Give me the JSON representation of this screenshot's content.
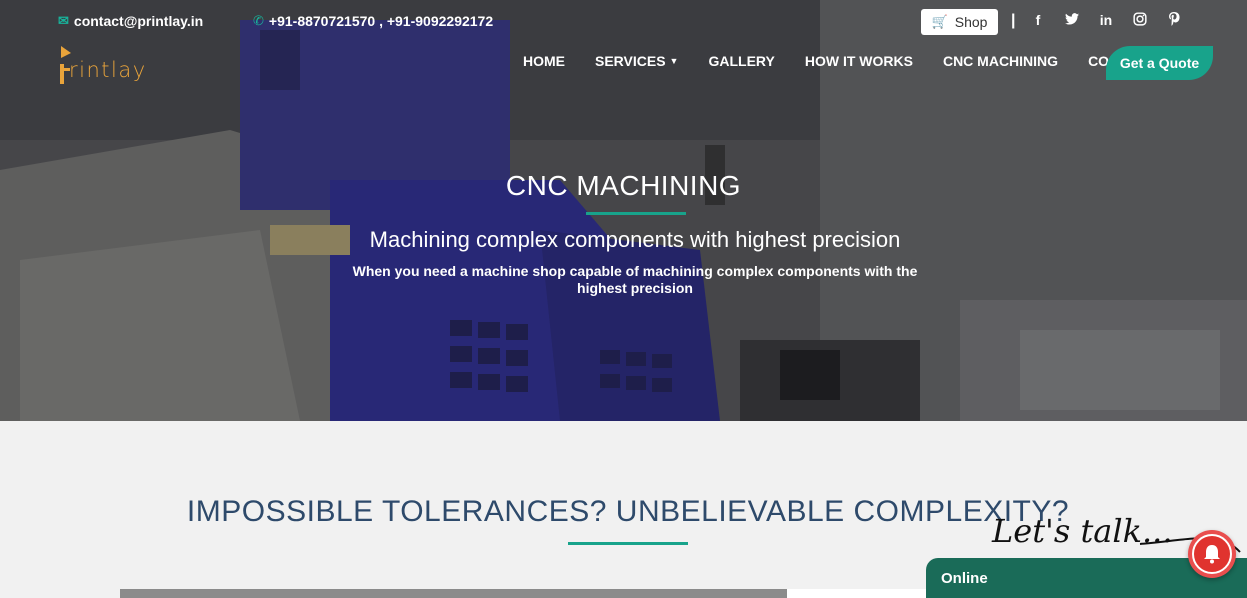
{
  "topbar": {
    "email": "contact@printlay.in",
    "phones": "+91-8870721570 , +91-9092292172",
    "shop_label": "Shop",
    "separator": "|",
    "social": [
      "facebook-icon",
      "twitter-icon",
      "linkedin-icon",
      "instagram-icon",
      "pinterest-icon"
    ],
    "social_glyphs": [
      "f",
      "🐦",
      "in",
      "◎",
      "℗"
    ]
  },
  "logo": {
    "text": "rintlay"
  },
  "nav": {
    "items": [
      "HOME",
      "SERVICES",
      "GALLERY",
      "HOW IT WORKS",
      "CNC MACHINING",
      "CONTACT"
    ],
    "quote_label": "Get a Quote"
  },
  "hero": {
    "title": "CNC MACHINING",
    "subtitle": "Machining complex components with highest precision",
    "description": "When you need a machine shop capable of machining complex components with the highest precision"
  },
  "section": {
    "title": "IMPOSSIBLE TOLERANCES? UNBELIEVABLE COMPLEXITY?"
  },
  "chat": {
    "lets_talk": "Let's talk...",
    "status": "Online"
  },
  "colors": {
    "accent": "#18a38b",
    "heading": "#2e4a6b",
    "chat_bar": "#1a6b58",
    "bell": "#e94e4e"
  }
}
